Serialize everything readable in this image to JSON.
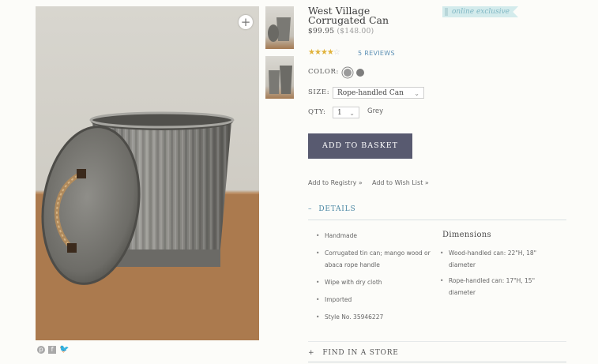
{
  "product": {
    "title": "West Village Corrugated Can",
    "badge": "online exclusive",
    "price": "$99.95",
    "original_price": "($148.00)",
    "rating": 4,
    "rating_max": 5,
    "reviews_label": "5 REVIEWS"
  },
  "options": {
    "color_label": "COLOR:",
    "colors": [
      "#8d8d8d",
      "#7d7d7d"
    ],
    "size_label": "SIZE:",
    "size_value": "Rope-handled Can",
    "qty_label": "QTY:",
    "qty_value": "1",
    "selected_color_name": "Grey"
  },
  "actions": {
    "add_to_basket": "ADD TO BASKET",
    "add_to_registry": "Add to Registry »",
    "add_to_wishlist": "Add to Wish List »"
  },
  "details": {
    "heading": "DETAILS",
    "toggle": "–",
    "items": [
      "Handmade",
      "Corrugated tin can; mango wood or abaca rope handle",
      "Wipe with dry cloth",
      "Imported",
      "Style No. 35946227"
    ],
    "dimensions_title": "Dimensions",
    "dimensions": [
      "Wood-handled can: 22\"H, 18\" diameter",
      "Rope-handled can: 17\"H, 15\" diameter"
    ]
  },
  "find_store": {
    "toggle": "+",
    "label": "FIND IN A STORE"
  },
  "icons": {
    "zoom": "zoom-plus-icon",
    "social": [
      "pinterest-icon",
      "facebook-icon",
      "twitter-icon"
    ]
  }
}
